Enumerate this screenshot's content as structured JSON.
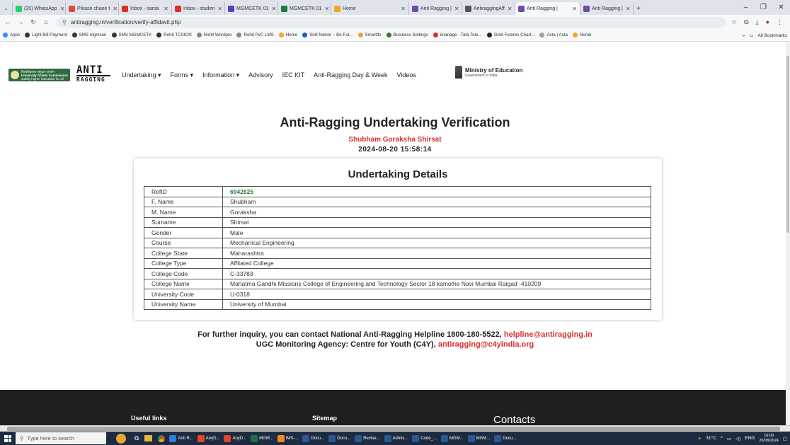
{
  "browser": {
    "tabs": [
      {
        "label": "(20) WhatsApp",
        "color": "#25d366"
      },
      {
        "label": "Please chane t",
        "color": "#e04a3a"
      },
      {
        "label": "Inbox - sarsa",
        "color": "#d93025"
      },
      {
        "label": "Inbox - studen",
        "color": "#d93025"
      },
      {
        "label": "MGMCETK 01",
        "color": "#5a3fb5"
      },
      {
        "label": "MGMCETK 01",
        "color": "#188038"
      },
      {
        "label": "Home",
        "color": "#f5a623"
      },
      {
        "label": "Anti Ragging |",
        "color": "#6c4fa3"
      },
      {
        "label": "AntiraggingAff",
        "color": "#555555"
      },
      {
        "label": "Anti Ragging |",
        "color": "#6c4fa3",
        "active": true
      },
      {
        "label": "Anti Ragging |",
        "color": "#6c4fa3"
      }
    ],
    "url": "antiragging.in/verification/verify-affidavit.php",
    "bookmarks": [
      {
        "label": "Apps",
        "color": "#4285f4"
      },
      {
        "label": "Light Bill Payment",
        "color": "#333333"
      },
      {
        "label": "SMS mgmcen",
        "color": "#333333"
      },
      {
        "label": "SMS MGMCETK",
        "color": "#333333"
      },
      {
        "label": "Rohit TCSION",
        "color": "#333333"
      },
      {
        "label": "Rohit Wordpro",
        "color": "#888888"
      },
      {
        "label": "Rohit PvC LMS",
        "color": "#888888"
      },
      {
        "label": "Home",
        "color": "#f5a623"
      },
      {
        "label": "Skill Nation – Be Fut...",
        "color": "#1a5fb4"
      },
      {
        "label": "Smartflo",
        "color": "#f0a030"
      },
      {
        "label": "Business Settings",
        "color": "#2e7d32"
      },
      {
        "label": "imanage - Tata Tele...",
        "color": "#d93025"
      },
      {
        "label": "Gold Futures Chart...",
        "color": "#222222"
      },
      {
        "label": "Asta | Asta",
        "color": "#9aa0a6"
      },
      {
        "label": "Home",
        "color": "#f5a623"
      }
    ],
    "all_bookmarks": "All Bookmarks"
  },
  "site": {
    "logo_ugc_line1": "विश्वविद्यालय अनुदान आयोग",
    "logo_ugc_line2": "University Grants Commission",
    "logo_ugc_line3": "quality higher education for all",
    "logo_anti_line1": "ANTI",
    "logo_anti_line2": "RAGGING",
    "nav": [
      {
        "label": "Undertaking ▾"
      },
      {
        "label": "Forms ▾"
      },
      {
        "label": "Information ▾"
      },
      {
        "label": "Advisory"
      },
      {
        "label": "IEC KIT"
      },
      {
        "label": "Anti-Ragging Day & Week"
      },
      {
        "label": "Videos"
      }
    ],
    "moe_title": "Ministry of Education",
    "moe_sub": "Government of India"
  },
  "main": {
    "title": "Anti-Ragging Undertaking Verification",
    "student_name": "Shubham Goraksha Shirsat",
    "timestamp": "2024-08-20 15:58:14",
    "card_title": "Undertaking Details",
    "rows": [
      {
        "key": "RefID",
        "value": "6942825"
      },
      {
        "key": "F. Name",
        "value": "Shubham"
      },
      {
        "key": "M. Name",
        "value": "Goraksha"
      },
      {
        "key": "Surname",
        "value": "Shirsat"
      },
      {
        "key": "Gender",
        "value": "Male"
      },
      {
        "key": "Course",
        "value": "Mechanical Engineering"
      },
      {
        "key": "College State",
        "value": "Maharashtra"
      },
      {
        "key": "College Type",
        "value": "Affliated College"
      },
      {
        "key": "College Code",
        "value": "C-33783"
      },
      {
        "key": "College Name",
        "value": "Mahatma Gandhi Missions College of Engineering and Technology Sector 18 kamothe Navi Mumbai Raigad -410209"
      },
      {
        "key": "University Code",
        "value": "U-0318"
      },
      {
        "key": "University Name",
        "value": "University of Mumbai"
      }
    ],
    "inquiry_text": "For further inquiry, you can contact National Anti-Ragging Helpline 1800-180-5522,",
    "inquiry_email": "helpline@antiragging.in",
    "agency_text": "UGC Monitoring Agency: Centre for Youth (C4Y),",
    "agency_email": "antiragging@c4yindia.org"
  },
  "footer": {
    "useful_links": "Useful links",
    "sitemap": "Sitemap",
    "contacts": "Contacts"
  },
  "taskbar": {
    "search_placeholder": "Type here to search",
    "apps": [
      {
        "label": "Anti R...",
        "color": "#2f7de1"
      },
      {
        "label": "AnyD...",
        "color": "#e2452c"
      },
      {
        "label": "AnyD...",
        "color": "#e2452c"
      },
      {
        "label": "MGM...",
        "color": "#1d7044"
      },
      {
        "label": "iMS-...",
        "color": "#f08a24"
      },
      {
        "label": "Docu...",
        "color": "#2b5797"
      },
      {
        "label": "Docu...",
        "color": "#2b5797"
      },
      {
        "label": "Revise...",
        "color": "#2b5797"
      },
      {
        "label": "Admis...",
        "color": "#2b5797"
      },
      {
        "label": "Code_...",
        "color": "#2b5797"
      },
      {
        "label": "MGM...",
        "color": "#2b5797"
      },
      {
        "label": "MGM...",
        "color": "#2b5797"
      },
      {
        "label": "Docu...",
        "color": "#2b5797"
      }
    ],
    "weather": "31°C",
    "lang": "ENG",
    "time": "16:09",
    "date": "20/08/2024"
  }
}
